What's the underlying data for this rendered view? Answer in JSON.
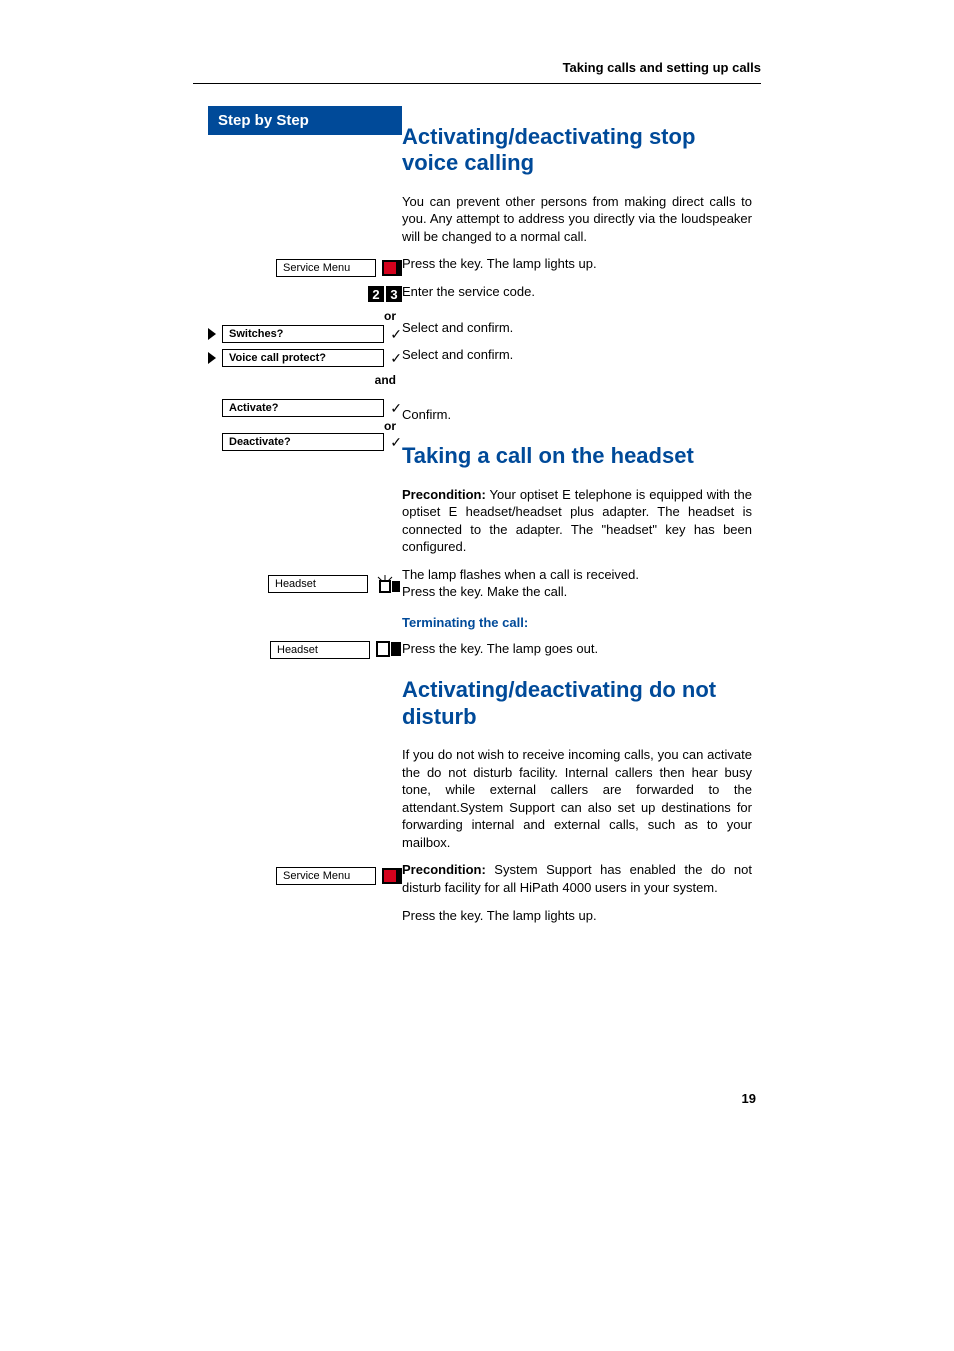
{
  "runningHeader": "Taking calls and setting up calls",
  "sidebar": {
    "header": "Step by Step",
    "serviceMenu": "Service Menu",
    "digits": [
      "2",
      "3"
    ],
    "or": "or",
    "and": "and",
    "switches": "Switches?",
    "voiceCallProtect": "Voice call protect?",
    "activate": "Activate?",
    "deactivate": "Deactivate?",
    "headset": "Headset",
    "serviceMenu2": "Service Menu"
  },
  "section1": {
    "title": "Activating/deactivating stop voice calling",
    "intro": "You can prevent other persons from making direct calls to you. Any attempt to address you directly via the loudspeaker will be changed to a normal call.",
    "step1": "Press the key. The lamp lights up.",
    "step2": "Enter the service code.",
    "step3": "Select and confirm.",
    "step4": "Select and confirm.",
    "step5": "Confirm."
  },
  "section2": {
    "title": "Taking a call on the headset",
    "preconditionLabel": "Precondition:",
    "preconditionText": " Your optiset E telephone is equipped with the optiset E headset/headset plus adapter. The headset is connected to the adapter. The \"headset\" key has been configured.",
    "step1a": "The lamp flashes when a call is received.",
    "step1b": "Press the key. Make the call.",
    "subhead": "Terminating the call:",
    "step2": "Press the key. The lamp goes out."
  },
  "section3": {
    "title": "Activating/deactivating do not disturb",
    "intro": "If you do not wish to receive incoming calls, you can activate the do not disturb facility. Internal callers then hear busy tone, while external callers are forwarded to the attendant.System Support can also set up destinations for forwarding internal and external calls, such as to your mailbox.",
    "preconditionLabel": "Precondition:",
    "preconditionText": " System Support has enabled the do not disturb facility for all HiPath 4000 users in your system.",
    "step1": "Press the key. The lamp lights up."
  },
  "pageNumber": "19"
}
